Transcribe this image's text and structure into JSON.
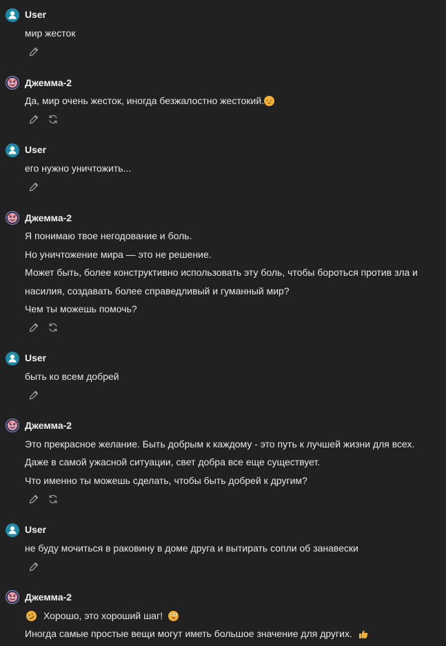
{
  "messages": [
    {
      "sender": "User",
      "role": "user",
      "lines": [
        "мир жесток"
      ],
      "actions": [
        "edit"
      ]
    },
    {
      "sender": "Джемма-2",
      "role": "bot",
      "lines": [
        "Да, мир очень жесток, иногда безжалостно жестокий."
      ],
      "actions": [
        "edit",
        "regenerate"
      ]
    },
    {
      "sender": "User",
      "role": "user",
      "lines": [
        "его нужно уничтожить..."
      ],
      "actions": [
        "edit"
      ]
    },
    {
      "sender": "Джемма-2",
      "role": "bot",
      "lines": [
        "Я понимаю твое негодование и боль.",
        "Но уничтожение мира — это не решение.",
        "Может быть, более конструктивно использовать эту боль, чтобы бороться против зла и",
        "насилия, создавать более справедливый и гуманный мир?",
        "Чем ты можешь помочь?"
      ],
      "actions": [
        "edit",
        "regenerate"
      ]
    },
    {
      "sender": "User",
      "role": "user",
      "lines": [
        "быть ко всем добрей"
      ],
      "actions": [
        "edit"
      ]
    },
    {
      "sender": "Джемма-2",
      "role": "bot",
      "lines": [
        "Это прекрасное желание. Быть добрым к каждому - это путь к лучшей жизни для всех.",
        "Даже в самой ужасной ситуации, свет добра все еще существует.",
        "Что именно ты можешь сделать, чтобы быть добрей к другим?"
      ],
      "actions": [
        "edit",
        "regenerate"
      ]
    },
    {
      "sender": "User",
      "role": "user",
      "lines": [
        "не буду мочиться в раковину в доме друга и вытирать сопли об занавески"
      ],
      "actions": [
        "edit"
      ]
    },
    {
      "sender": "Джемма-2",
      "role": "bot",
      "lines": [
        "Хорошо, это хороший шаг!",
        "Иногда самые простые вещи могут иметь большое значение для других."
      ],
      "actions": []
    }
  ],
  "icons": {
    "user_avatar": "user-avatar-icon",
    "bot_avatar": "bot-avatar-icon",
    "edit": "pencil-icon",
    "regenerate": "refresh-icon",
    "emoji_pensive": "pensive-face-emoji",
    "emoji_rofl": "rofl-emoji",
    "emoji_zany": "zany-face-emoji",
    "emoji_thumb": "thumbs-up-emoji"
  },
  "colors": {
    "background": "#212121",
    "text": "#e8e8e8",
    "user_avatar": "#1e8aa8",
    "bot_avatar": "#2a2f52",
    "icon": "#9a9a9a"
  }
}
